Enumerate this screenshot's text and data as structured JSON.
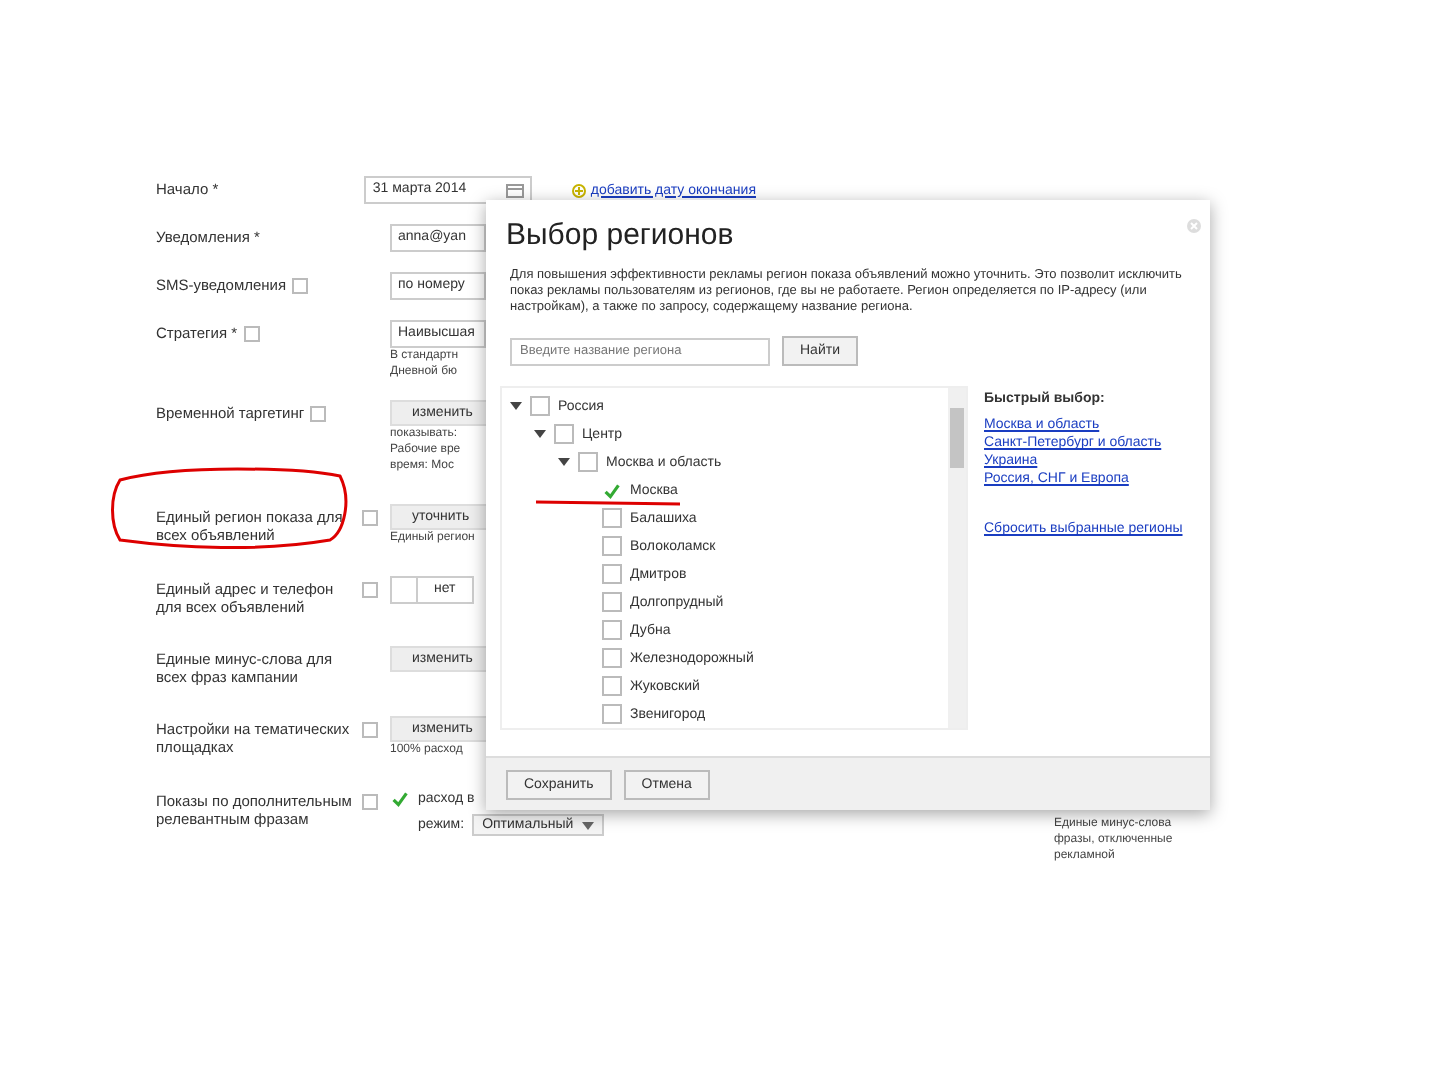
{
  "form": {
    "rows": [
      {
        "label": "Начало *",
        "help": false,
        "controls": [
          {
            "kind": "date",
            "value": "31 марта 2014"
          },
          {
            "kind": "link",
            "text": "добавить дату окончания"
          }
        ]
      },
      {
        "label": "Уведомления *",
        "help": false,
        "controls": [
          {
            "kind": "input",
            "value": "anna@yan"
          }
        ]
      },
      {
        "label": "SMS-уведомления",
        "help": true,
        "controls": [
          {
            "kind": "input",
            "value": "по номеру"
          }
        ]
      },
      {
        "label": "Стратегия *",
        "help": true,
        "controls": [
          {
            "kind": "input",
            "value": "Наивысшая"
          },
          {
            "kind": "note",
            "text": "В стандартн"
          },
          {
            "kind": "note",
            "text": "Дневной бю"
          }
        ]
      },
      {
        "label": "Временной таргетинг",
        "help": true,
        "controls": [
          {
            "kind": "button",
            "text": "изменить"
          },
          {
            "kind": "note",
            "text": "показывать:"
          },
          {
            "kind": "note",
            "text": "Рабочие вре"
          },
          {
            "kind": "note",
            "text": "время: Мос"
          }
        ]
      },
      {
        "label": "Единый регион показа для всех объявлений",
        "help": true,
        "controls": [
          {
            "kind": "button",
            "text": "уточнить"
          },
          {
            "kind": "note",
            "text": "Единый регион"
          }
        ]
      },
      {
        "label": "Единый адрес и телефон для всех объявлений",
        "help": true,
        "controls": [
          {
            "kind": "toggle",
            "text": "нет",
            "on": false
          }
        ]
      },
      {
        "label": "Единые минус-слова для всех фраз кампании",
        "help": false,
        "controls": [
          {
            "kind": "button",
            "text": "изменить"
          }
        ]
      },
      {
        "label": "Настройки на тематических площадках",
        "help": true,
        "controls": [
          {
            "kind": "button",
            "text": "изменить"
          },
          {
            "kind": "note",
            "text": "100% расход"
          }
        ]
      },
      {
        "label": "Показы по дополнительным релевантным фразам",
        "help": true,
        "controls": [
          {
            "kind": "checkbox",
            "text": "расход в",
            "checked": true
          },
          {
            "kind": "select",
            "label": "режим:",
            "value": "Оптимальный"
          }
        ]
      }
    ]
  },
  "side_note": [
    "Единые минус-слова",
    "фразы, отключенные",
    "рекламной"
  ],
  "dialog": {
    "title": "Выбор регионов",
    "description": "Для повышения эффективности рекламы регион показа объявлений можно уточнить. Это позволит исключить показ рекламы пользователям из регионов, где вы не работаете. Регион определяется по IP-адресу (или настройкам), а также по запросу, содержащему название региона.",
    "search": {
      "placeholder": "Введите название региона",
      "button": "Найти"
    },
    "tree": [
      {
        "label": "Россия",
        "checked": false,
        "expanded": true,
        "children": [
          {
            "label": "Центр",
            "checked": false,
            "expanded": true,
            "children": [
              {
                "label": "Москва и область",
                "checked": false,
                "expanded": true,
                "children": [
                  {
                    "label": "Москва",
                    "checked": true
                  },
                  {
                    "label": "Балашиха",
                    "checked": false
                  },
                  {
                    "label": "Волоколамск",
                    "checked": false
                  },
                  {
                    "label": "Дмитров",
                    "checked": false
                  },
                  {
                    "label": "Долгопрудный",
                    "checked": false
                  },
                  {
                    "label": "Дубна",
                    "checked": false
                  },
                  {
                    "label": "Железнодорожный",
                    "checked": false
                  },
                  {
                    "label": "Жуковский",
                    "checked": false
                  },
                  {
                    "label": "Звенигород",
                    "checked": false
                  }
                ]
              }
            ]
          }
        ]
      }
    ],
    "quick": {
      "title": "Быстрый выбор:",
      "links": [
        "Москва и область",
        "Санкт-Петербург и область",
        "Украина",
        "Россия, СНГ и Европа"
      ],
      "reset": "Сбросить выбранные регионы"
    },
    "buttons": [
      "Сохранить",
      "Отмена"
    ]
  }
}
